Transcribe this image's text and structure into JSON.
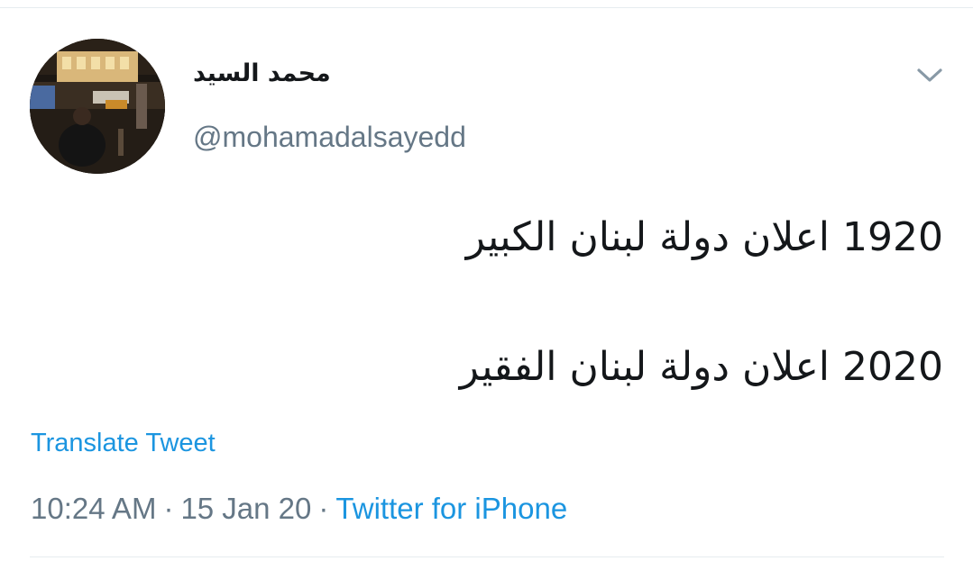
{
  "tweet": {
    "display_name": "محمد السيد",
    "handle": "@mohamadalsayedd",
    "lines": [
      "1920 اعلان دولة لبنان الكبير",
      "2020 اعلان دولة لبنان الفقير"
    ],
    "translate_label": "Translate Tweet",
    "time": "10:24 AM",
    "date": "15 Jan 20",
    "source": "Twitter for iPhone",
    "separator": "·"
  },
  "icons": {
    "avatar": "profile-photo",
    "menu": "chevron-down-icon"
  },
  "colors": {
    "link": "#1b95e0",
    "secondary_text": "#657786",
    "primary_text": "#14171a",
    "divider": "#e6ecf0"
  }
}
